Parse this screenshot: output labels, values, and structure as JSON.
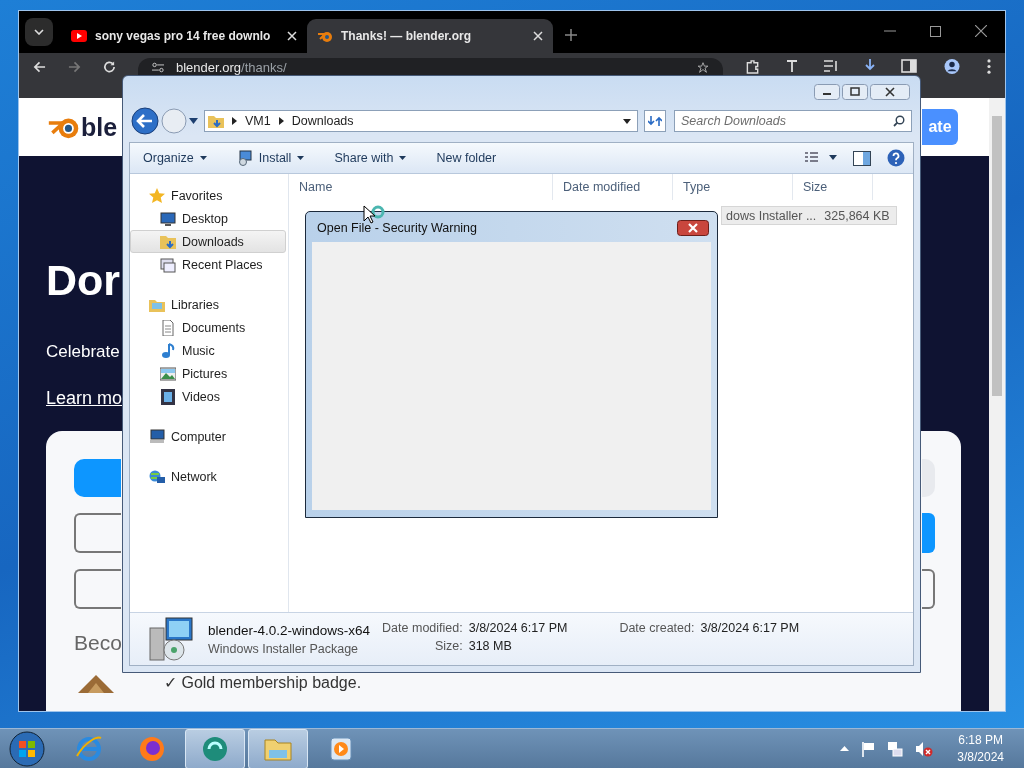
{
  "browser": {
    "tabs": [
      {
        "title": "sony vegas pro 14 free downlo",
        "selected": false
      },
      {
        "title": "Thanks! — blender.org",
        "selected": true
      }
    ],
    "address": {
      "host": "blender.org",
      "path": "/thanks/"
    },
    "page": {
      "logo_text": "ble",
      "header_button": "ate",
      "heading": "Dor",
      "subtitle": "Celebrate",
      "link": "Learn mo",
      "frequency": [
        {
          "selected": true
        },
        {
          "selected": false
        }
      ],
      "amounts": [
        {
          "selected": false
        },
        {
          "selected": true
        },
        {
          "selected": false
        },
        {
          "selected": false
        }
      ],
      "section_heading": "Beco",
      "perk": {
        "mark": "✓",
        "text": "Gold membership badge."
      }
    }
  },
  "explorer": {
    "breadcrumb": [
      "VM1",
      "Downloads"
    ],
    "search": {
      "placeholder": "Search Downloads"
    },
    "commands": [
      {
        "label": "Organize",
        "dropdown": true
      },
      {
        "label": "Install",
        "dropdown": true
      },
      {
        "label": "Share with",
        "dropdown": true
      },
      {
        "label": "New folder",
        "dropdown": false
      }
    ],
    "nav": [
      {
        "label": "Favorites",
        "children": [
          {
            "label": "Desktop",
            "selected": false
          },
          {
            "label": "Downloads",
            "selected": true
          },
          {
            "label": "Recent Places",
            "selected": false
          }
        ]
      },
      {
        "label": "Libraries",
        "children": [
          {
            "label": "Documents",
            "selected": false
          },
          {
            "label": "Music",
            "selected": false
          },
          {
            "label": "Pictures",
            "selected": false
          },
          {
            "label": "Videos",
            "selected": false
          }
        ]
      },
      {
        "label": "Computer"
      },
      {
        "label": "Network"
      }
    ],
    "columns": [
      "Name",
      "Date modified",
      "Type",
      "Size"
    ],
    "files": [
      {
        "type": "dows Installer ...",
        "size": "325,864 KB",
        "selected": true
      }
    ],
    "details": {
      "name": "blender-4.0.2-windows-x64",
      "kind": "Windows Installer Package",
      "fields": [
        {
          "label": "Date modified:",
          "value": "3/8/2024 6:17 PM"
        },
        {
          "label": "Size:",
          "value": "318 MB"
        },
        {
          "label": "Date created:",
          "value": "3/8/2024 6:17 PM"
        }
      ]
    }
  },
  "dialog": {
    "title": "Open File - Security Warning"
  },
  "taskbar": {
    "apps": [
      {
        "active": false
      },
      {
        "active": false
      },
      {
        "active": true
      },
      {
        "active": true
      },
      {
        "active": false
      }
    ],
    "time": "6:18 PM",
    "date": "3/8/2024"
  }
}
